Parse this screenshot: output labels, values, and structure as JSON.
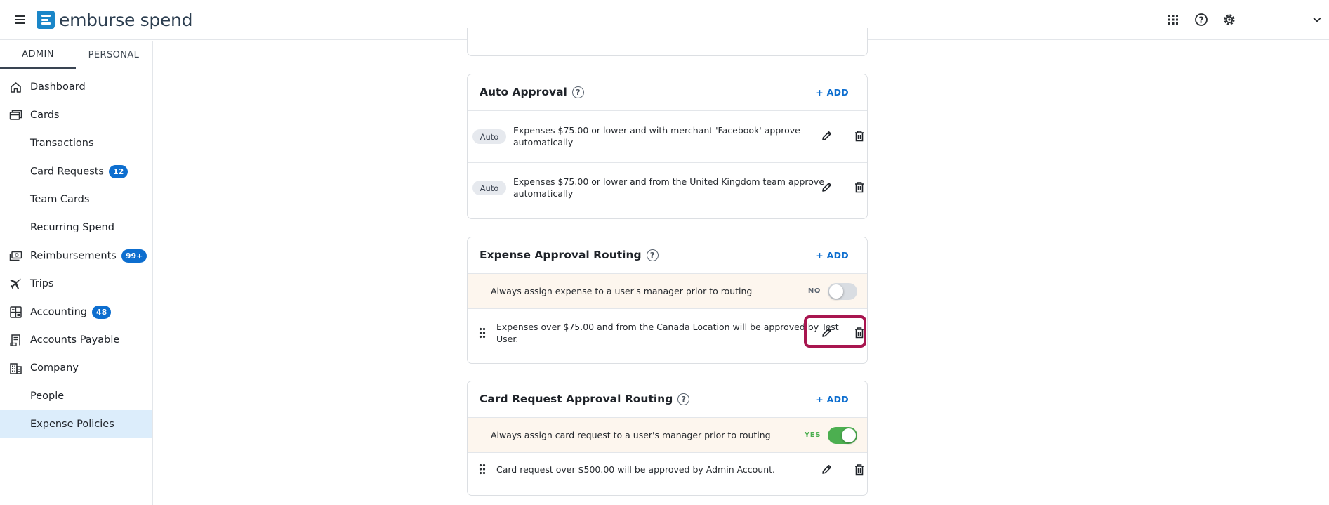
{
  "header": {
    "logo_text": "emburse spend",
    "brand_color": "#1a86c8",
    "icons": [
      "menu-icon",
      "apps-grid-icon",
      "help-circle-icon",
      "gear-icon",
      "chevron-down-icon"
    ]
  },
  "sidebar": {
    "tabs": [
      {
        "label": "ADMIN",
        "active": true
      },
      {
        "label": "PERSONAL",
        "active": false
      }
    ],
    "items": [
      {
        "label": "Dashboard",
        "icon": "home-icon"
      },
      {
        "label": "Cards",
        "icon": "cards-icon"
      },
      {
        "label": "Transactions"
      },
      {
        "label": "Card Requests",
        "badge": "12"
      },
      {
        "label": "Team Cards"
      },
      {
        "label": "Recurring Spend"
      },
      {
        "label": "Reimbursements",
        "icon": "money-icon",
        "badge": "99+"
      },
      {
        "label": "Trips",
        "icon": "airplane-icon"
      },
      {
        "label": "Accounting",
        "icon": "calculator-icon",
        "badge": "48"
      },
      {
        "label": "Accounts Payable",
        "icon": "invoice-icon"
      },
      {
        "label": "Company",
        "icon": "building-icon"
      },
      {
        "label": "People"
      },
      {
        "label": "Expense Policies",
        "active": true
      }
    ],
    "active_color": "#dcedfb",
    "badge_color": "#0d6ecf"
  },
  "auto_approval": {
    "title": "Auto Approval",
    "add_label": "+ ADD",
    "rules": [
      {
        "pill": "Auto",
        "line1": "Expenses $75.00 or lower and with merchant 'Facebook' approve",
        "line2": "automatically"
      },
      {
        "pill": "Auto",
        "line1": "Expenses $75.00 or lower and from the United Kingdom team approve",
        "line2": "automatically"
      }
    ]
  },
  "expense_routing": {
    "title": "Expense Approval Routing",
    "add_label": "+ ADD",
    "toggle_text": "Always assign expense to a user's manager prior to routing",
    "toggle_state_label": "NO",
    "toggle_on": false,
    "rules": [
      {
        "line1": "Expenses over $75.00 and from the Canada Location will be approved by Test",
        "line2": "User."
      }
    ]
  },
  "card_request_routing": {
    "title": "Card Request Approval Routing",
    "add_label": "+ ADD",
    "toggle_text": "Always assign card request to a user's manager prior to routing",
    "toggle_state_label": "YES",
    "toggle_on": true,
    "toggle_on_color": "#4caf50",
    "rules": [
      {
        "line1": "Card request over $500.00 will be approved by Admin Account."
      }
    ]
  },
  "highlight_color": "#a8154f"
}
